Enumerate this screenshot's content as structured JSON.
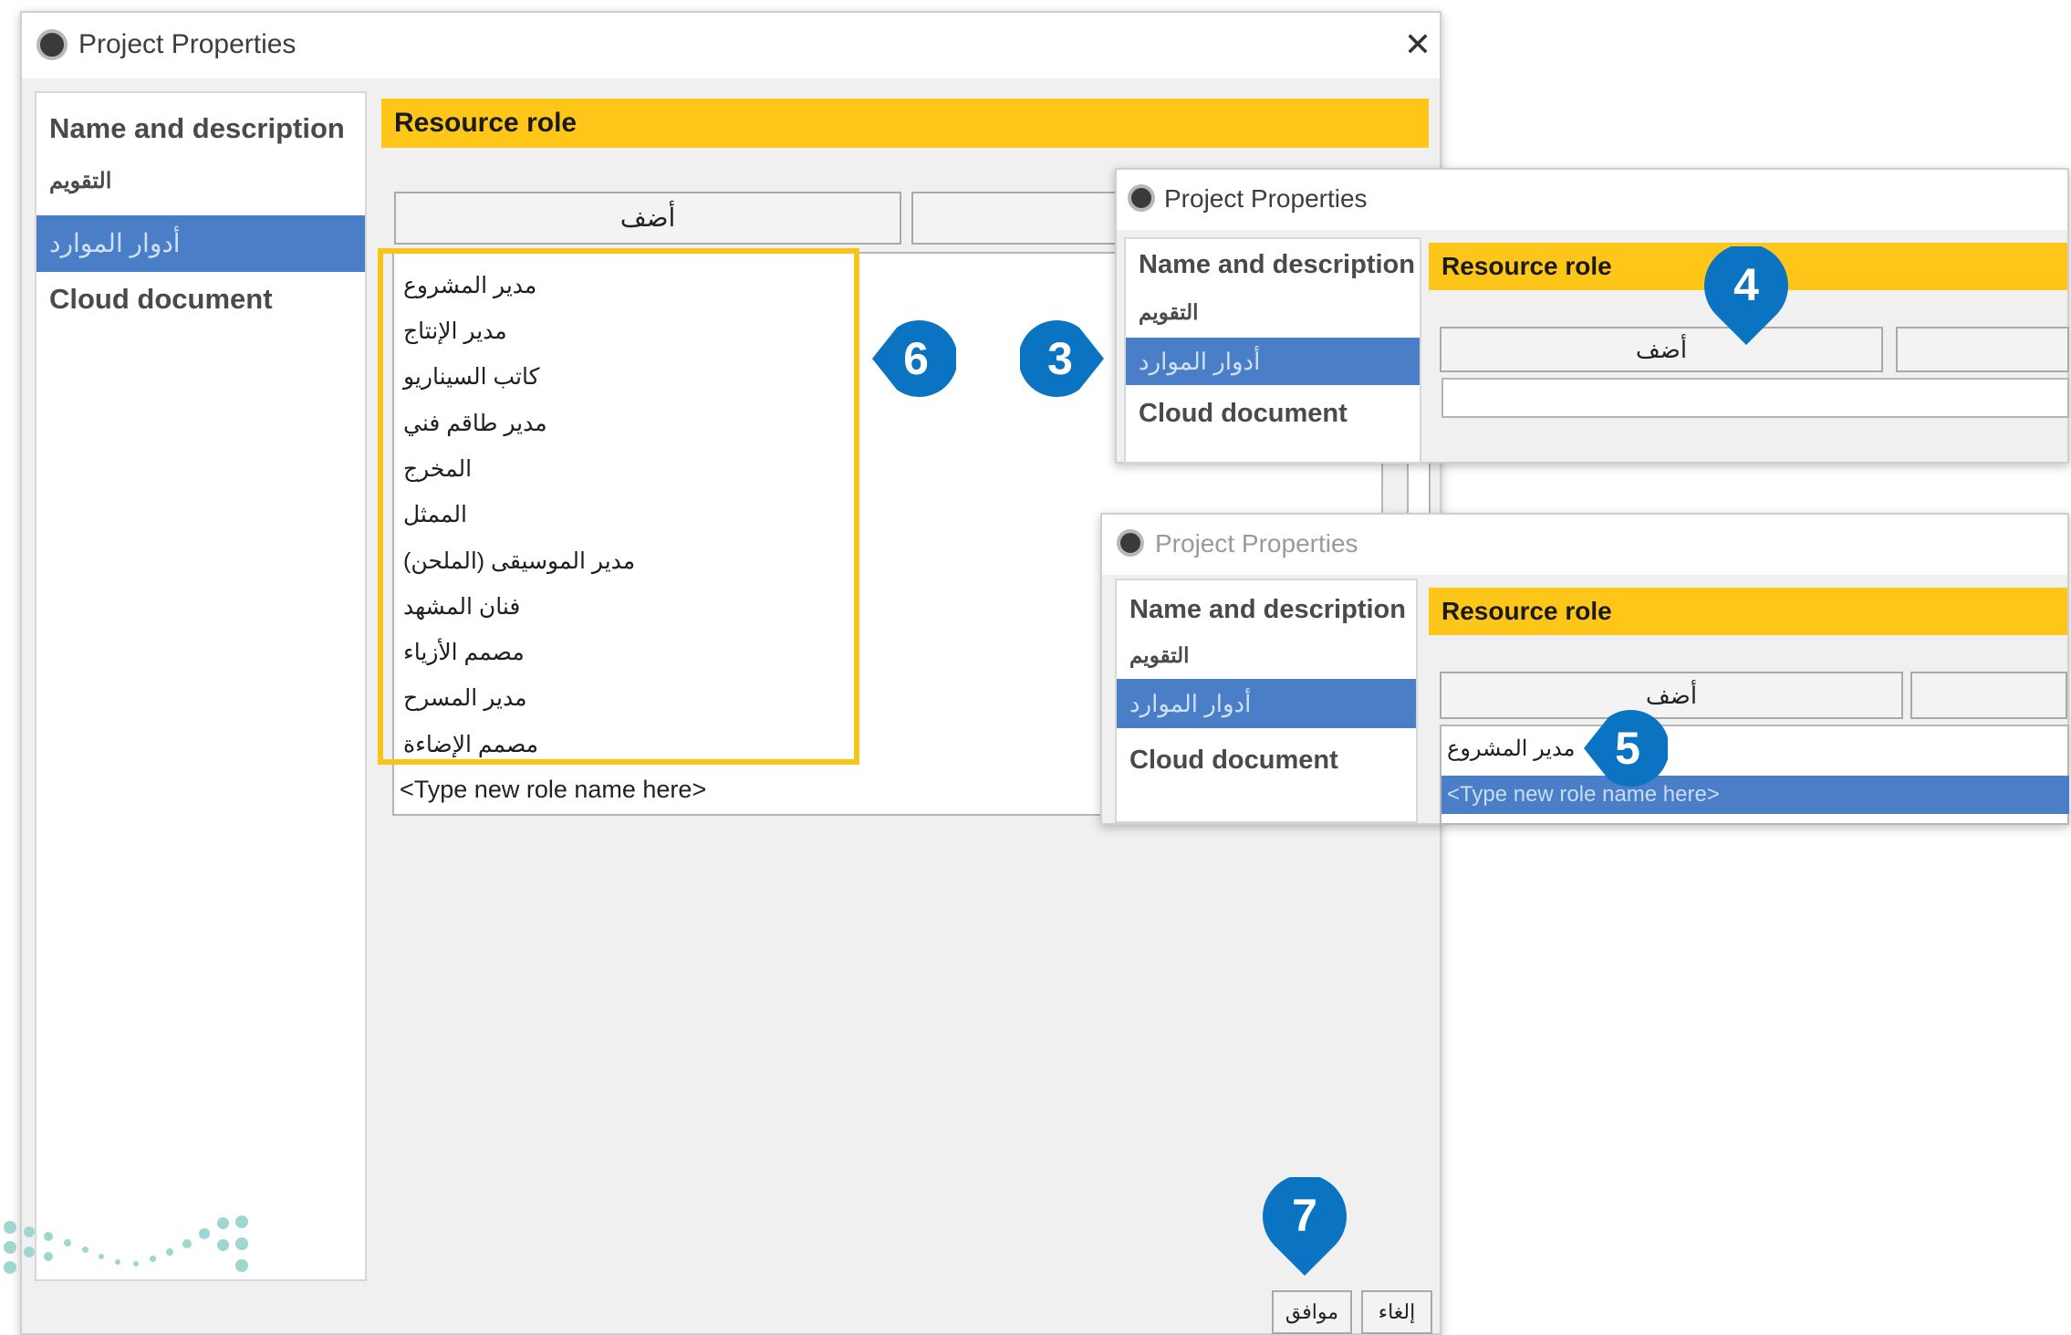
{
  "main_window": {
    "title": "Project Properties",
    "close_glyph": "✕",
    "nav_items": [
      "Name and description",
      "التقويم",
      "أدوار الموارد",
      "Cloud document"
    ],
    "selected_nav": "أدوار الموارد",
    "section_header": "Resource role",
    "add_button_label": "أضف",
    "roles": [
      "مدير المشروع",
      "مدير الإنتاج",
      "كاتب السيناريو",
      "مدير طاقم فني",
      "المخرج",
      "الممثل",
      "مدير الموسيقى (الملحن)",
      "فنان المشهد",
      "مصمم الأزياء",
      "مدير المسرح",
      "مصمم الإضاءة"
    ],
    "new_role_placeholder": "<Type new role name here>",
    "ok_button_label": "موافق",
    "cancel_button_label": "إلغاء"
  },
  "inset_window_1": {
    "title": "Project Properties",
    "nav_items": [
      "Name and description",
      "التقويم",
      "أدوار الموارد",
      "Cloud document"
    ],
    "section_header": "Resource role",
    "add_button_label": "أضف"
  },
  "inset_window_2": {
    "title": "Project Properties",
    "nav_items": [
      "Name and description",
      "التقويم",
      "أدوار الموارد",
      "Cloud document"
    ],
    "section_header": "Resource role",
    "add_button_label": "أضف",
    "role_item": "مدير المشروع",
    "new_role_placeholder": "<Type new role name here>"
  },
  "step_markers": [
    "3",
    "4",
    "5",
    "6",
    "7"
  ],
  "colors": {
    "header_yellow": "#ffc61a",
    "selection_blue": "#4a7fc8",
    "marker_blue": "#0a74c2",
    "highlight_yellow": "#f5c51b",
    "logo_dots": "#9fd6cf"
  },
  "icons": [
    "app-icon",
    "close-icon",
    "step-marker-icon",
    "logo-dots"
  ]
}
